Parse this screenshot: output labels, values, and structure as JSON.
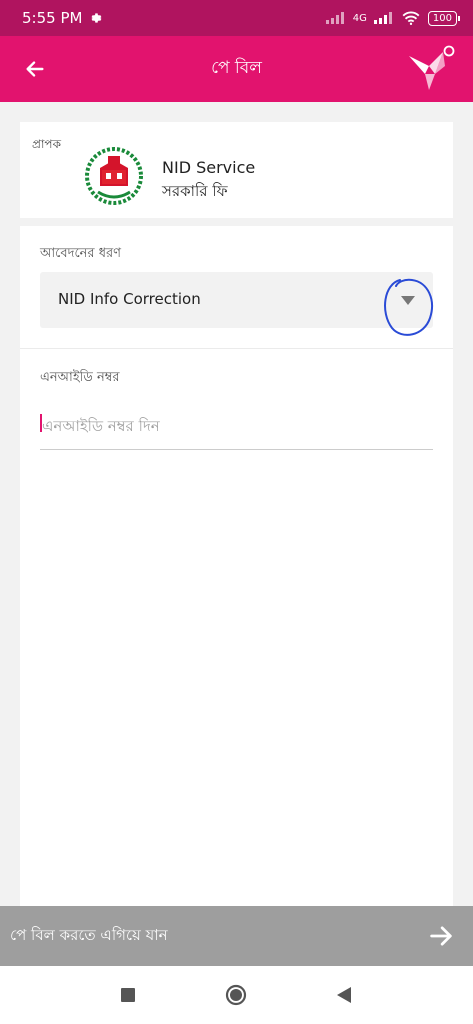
{
  "status_bar": {
    "time": "5:55 PM",
    "battery": "100",
    "network": "4G"
  },
  "app_bar": {
    "title": "পে বিল"
  },
  "recipient": {
    "label": "প্রাপক",
    "name": "NID Service",
    "subtitle": "সরকারি ফি"
  },
  "form": {
    "type_label": "আবেদনের ধরণ",
    "type_value": "NID Info Correction",
    "nid_label": "এনআইডি নম্বর",
    "nid_placeholder": "এনআইডি নম্বর দিন"
  },
  "footer": {
    "proceed_label": "পে বিল করতে এগিয়ে যান"
  },
  "colors": {
    "brand": "#e2136e",
    "status": "#b0145f",
    "disabled": "#9e9e9e"
  }
}
